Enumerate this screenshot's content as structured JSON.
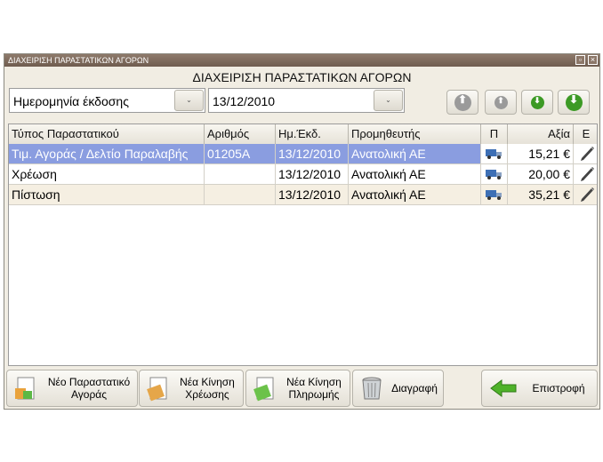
{
  "window": {
    "title": "ΔΙΑΧΕΙΡΙΣΗ ΠΑΡΑΣΤΑΤΙΚΩΝ ΑΓΟΡΩΝ"
  },
  "heading": "ΔΙΑΧΕΙΡΙΣΗ ΠΑΡΑΣΤΑΤΙΚΩΝ ΑΓΟΡΩΝ",
  "filter": {
    "field": "Ημερομηνία έκδοσης",
    "value": "13/12/2010"
  },
  "table": {
    "columns": [
      "Τύπος Παραστατικού",
      "Αριθμός",
      "Ημ.Έκδ.",
      "Προμηθευτής",
      "Π",
      "Αξία",
      "Ε"
    ],
    "rows": [
      {
        "type": "Τιμ. Αγοράς / Δελτίο Παραλαβής",
        "number": "01205A",
        "date": "13/12/2010",
        "supplier": "Ανατολική ΑΕ",
        "value": "15,21 €",
        "selected": true
      },
      {
        "type": "Χρέωση",
        "number": "",
        "date": "13/12/2010",
        "supplier": "Ανατολική ΑΕ",
        "value": "20,00 €",
        "selected": false
      },
      {
        "type": "Πίστωση",
        "number": "",
        "date": "13/12/2010",
        "supplier": "Ανατολική ΑΕ",
        "value": "35,21 €",
        "selected": false
      }
    ]
  },
  "buttons": {
    "new_purchase_1": "Νέο Παραστατικό",
    "new_purchase_2": "Αγοράς",
    "new_charge_1": "Νέα Κίνηση",
    "new_charge_2": "Χρέωσης",
    "new_payment_1": "Νέα Κίνηση",
    "new_payment_2": "Πληρωμής",
    "delete": "Διαγραφή",
    "back": "Επιστροφή"
  },
  "colors": {
    "selected_row": "#8a9de0",
    "alt_row": "#f5efe2",
    "nav_gray": "#9a9a9a",
    "nav_green": "#3c9a25"
  }
}
